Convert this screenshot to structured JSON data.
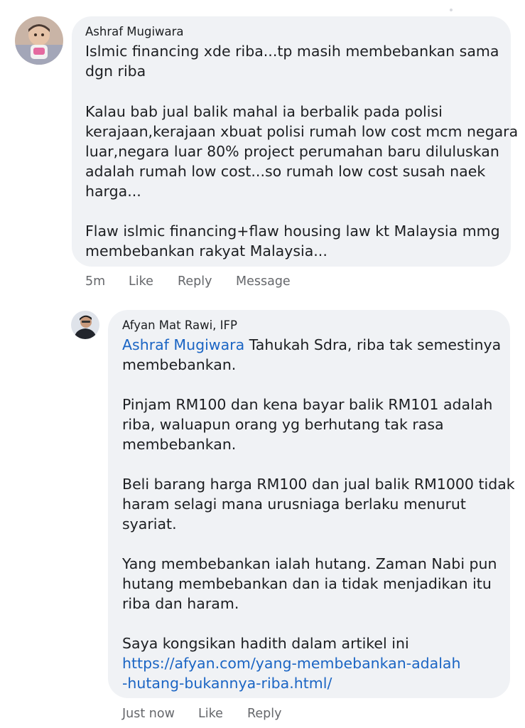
{
  "comment1": {
    "author": "Ashraf Mugiwara",
    "lines": [
      "Islmic financing xde riba...tp masih membebankan sama",
      "dgn riba",
      "Kalau bab jual balik mahal ia berbalik pada polisi",
      "kerajaan,kerajaan xbuat polisi rumah low cost mcm negara",
      "luar,negara luar 80% project perumahan baru diluluskan",
      "adalah rumah low cost...so rumah low cost susah naek",
      "harga...",
      "Flaw islmic financing+flaw housing law kt Malaysia mmg",
      "membebankan rakyat Malaysia..."
    ],
    "time": "5m",
    "like": "Like",
    "reply": "Reply",
    "message": "Message",
    "avatar_icon": "child-photo-avatar"
  },
  "comment2": {
    "author": "Afyan Mat Rawi, IFP",
    "mention": "Ashraf Mugiwara",
    "first_line_rest": " Tahukah Sdra, riba tak semestinya",
    "lines": [
      "membebankan.",
      "Pinjam RM100 dan kena bayar balik RM101 adalah",
      "riba, waluapun orang yg berhutang tak rasa",
      "membebankan.",
      "Beli barang harga RM100 dan jual balik RM1000 tidak",
      "haram selagi mana urusniaga berlaku menurut",
      "syariat.",
      "Yang membebankan ialah hutang. Zaman Nabi pun",
      "hutang membebankan dan ia tidak menjadikan itu",
      "riba dan haram.",
      "Saya kongsikan hadith dalam artikel ini"
    ],
    "link_lines": [
      "https://afyan.com/yang-membebankan-adalah",
      "-hutang-bukannya-riba.html/"
    ],
    "time": "Just now",
    "like": "Like",
    "reply": "Reply",
    "avatar_icon": "man-portrait-avatar"
  },
  "colors": {
    "bubble": "#f0f2f5",
    "link": "#1b65c4",
    "meta": "#65676b"
  }
}
